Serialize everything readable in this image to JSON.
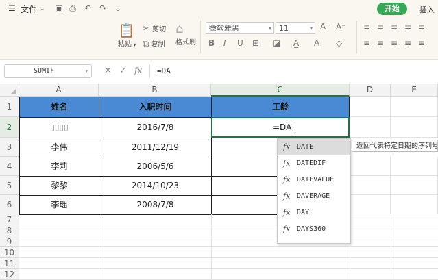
{
  "menubar": {
    "menu_label": "文件",
    "start_tab": "开始",
    "insert_tab": "插入"
  },
  "ribbon": {
    "paste": "粘贴",
    "cut": "剪切",
    "copy": "复制",
    "format_painter": "格式刷",
    "font_name": "微软雅黑",
    "font_size": "11"
  },
  "formula_bar": {
    "name_box": "SUMIF",
    "fx_label": "fx",
    "formula": "=DA"
  },
  "columns": [
    "A",
    "B",
    "C",
    "D",
    "E"
  ],
  "rows": [
    "1",
    "2",
    "3",
    "4",
    "5",
    "6",
    "7",
    "8",
    "9",
    "10",
    "11",
    "12"
  ],
  "table": {
    "headers": [
      "姓名",
      "入职时间",
      "工龄"
    ],
    "data": [
      [
        "▯▯▯▯",
        "2016/7/8",
        "=DA"
      ],
      [
        "李伟",
        "2011/12/19",
        ""
      ],
      [
        "李莉",
        "2006/5/6",
        ""
      ],
      [
        "黎黎",
        "2014/10/23",
        ""
      ],
      [
        "李瑶",
        "2008/7/8",
        ""
      ]
    ]
  },
  "autocomplete": {
    "items": [
      "DATE",
      "DATEDIF",
      "DATEVALUE",
      "DAVERAGE",
      "DAY",
      "DAYS360"
    ],
    "selected_index": 0,
    "tooltip": "返回代表特定日期的序列号"
  },
  "colors": {
    "header_fill": "#4a8ad4",
    "selection": "#217346",
    "start_button": "#35a855"
  }
}
